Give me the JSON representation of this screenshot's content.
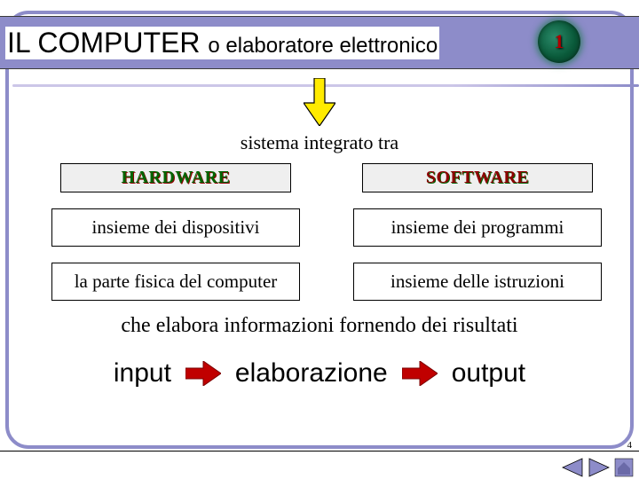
{
  "header": {
    "title_main": "IL COMPUTER ",
    "title_sub": "o elaboratore elettronico",
    "badge_number": "1"
  },
  "content": {
    "lead_in": "sistema integrato tra",
    "columns": [
      {
        "heading": "HARDWARE",
        "row1": "insieme dei dispositivi",
        "row2": "la parte fisica del computer"
      },
      {
        "heading": "SOFTWARE",
        "row1": "insieme dei programmi",
        "row2": "insieme delle istruzioni"
      }
    ],
    "process_line": "che elabora informazioni fornendo dei risultati",
    "flow": {
      "step1": "input",
      "step2": "elaborazione",
      "step3": "output"
    }
  },
  "footer": {
    "page_number": "4"
  },
  "colors": {
    "band": "#8d8cc9",
    "arrow_fill": "#ffeb00",
    "arrow_red": "#c00000"
  }
}
